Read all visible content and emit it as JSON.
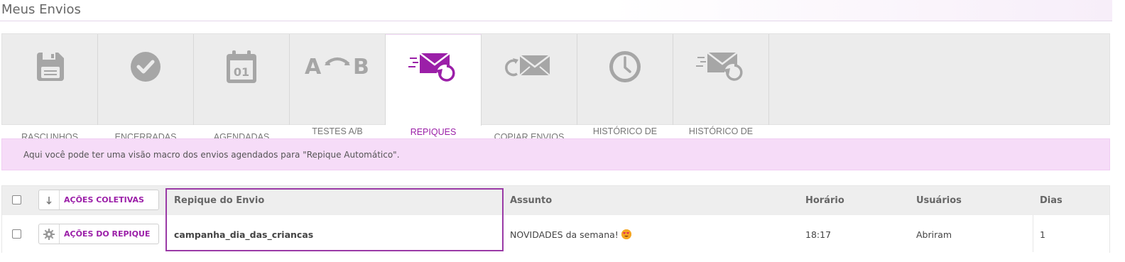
{
  "page": {
    "title": "Meus Envios"
  },
  "tabs": [
    {
      "label": "RASCUNHOS",
      "icon": "floppy-disk-icon",
      "active": false
    },
    {
      "label": "ENCERRADAS",
      "icon": "check-circle-icon",
      "active": false
    },
    {
      "label": "AGENDADAS",
      "icon": "calendar-01-icon",
      "active": false
    },
    {
      "label": "TESTES A/B\nAGENDADOS",
      "icon": "ab-test-icon",
      "active": false
    },
    {
      "label": "REPIQUES\nAGENDADOS",
      "icon": "scheduled-resend-envelope-icon",
      "active": true
    },
    {
      "label": "COPIAR ENVIOS",
      "icon": "copy-envelope-icon",
      "active": false
    },
    {
      "label": "HISTÓRICO DE\nENVIOS",
      "icon": "clock-icon",
      "active": false
    },
    {
      "label": "HISTÓRICO DE\nREPIQUES",
      "icon": "resend-history-envelope-icon",
      "active": false
    }
  ],
  "info": {
    "text": "Aqui você pode ter uma visão macro dos envios agendados para \"Repique Automático\"."
  },
  "table": {
    "bulk_actions_label": "AÇÕES COLETIVAS",
    "columns": {
      "repique": "Repique do Envio",
      "assunto": "Assunto",
      "horario": "Horário",
      "usuarios": "Usuários",
      "dias": "Dias"
    },
    "rows": [
      {
        "actions_label": "AÇÕES DO REPIQUE",
        "repique": "campanha_dia_das_criancas",
        "assunto": "NOVIDADES da semana!",
        "assunto_emoji": "heart-eyes-emoji",
        "horario": "18:17",
        "usuarios": "Abriram",
        "dias": "1"
      }
    ]
  },
  "colors": {
    "accent": "#9b1fa8",
    "banner": "#f6dcf8",
    "highlight": "#9a3aa6"
  }
}
